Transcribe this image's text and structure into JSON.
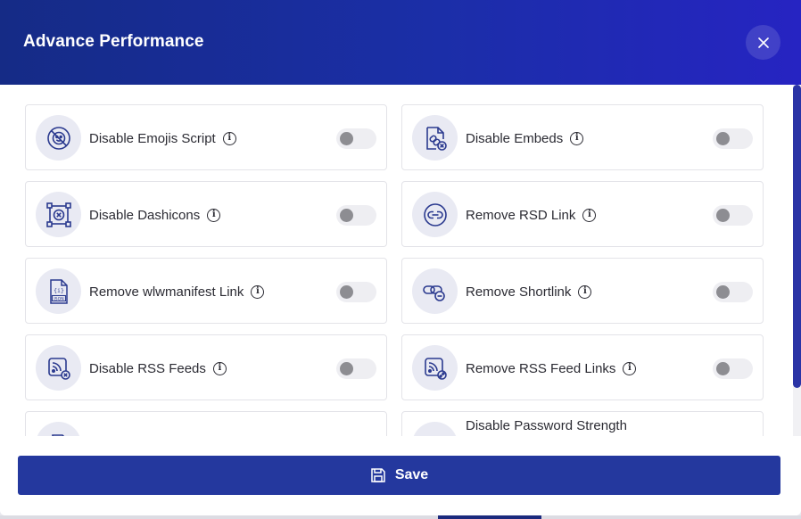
{
  "modal": {
    "title": "Advance Performance",
    "close_icon": "close-icon"
  },
  "settings": [
    {
      "label": "Disable Emojis Script",
      "icon": "emoji-disabled-icon",
      "enabled": false
    },
    {
      "label": "Disable Embeds",
      "icon": "embed-link-disabled-icon",
      "enabled": false
    },
    {
      "label": "Disable Dashicons",
      "icon": "dashicons-disabled-icon",
      "enabled": false
    },
    {
      "label": "Remove RSD Link",
      "icon": "rsd-link-icon",
      "enabled": false
    },
    {
      "label": "Remove wlwmanifest Link",
      "icon": "json-file-icon",
      "enabled": false
    },
    {
      "label": "Remove Shortlink",
      "icon": "shortlink-remove-icon",
      "enabled": false
    },
    {
      "label": "Disable RSS Feeds",
      "icon": "rss-feed-disabled-icon",
      "enabled": false
    },
    {
      "label": "Remove RSS Feed Links",
      "icon": "rss-feed-link-icon",
      "enabled": false
    },
    {
      "label": "",
      "icon": "file-icon",
      "enabled": false
    },
    {
      "label": "Disable Password Strength",
      "icon": "password-icon",
      "enabled": false
    }
  ],
  "footer": {
    "save_label": "Save",
    "save_icon": "floppy-disk-icon"
  },
  "colors": {
    "header_start": "#152b86",
    "header_end": "#2624c2",
    "primary_button": "#24389e",
    "icon_stroke": "#2b3a8f",
    "toggle_off_knob": "#8d8d92"
  }
}
